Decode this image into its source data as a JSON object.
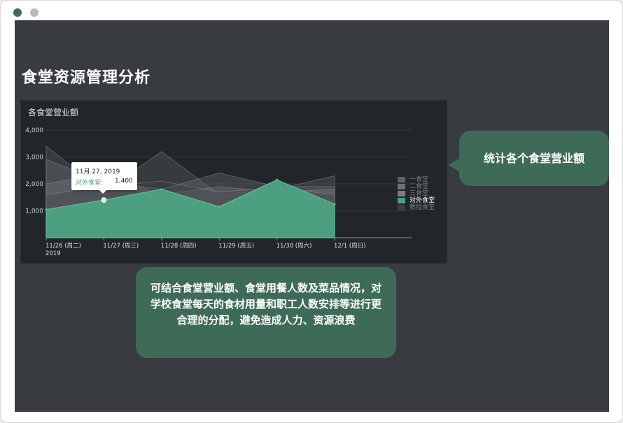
{
  "window": {
    "controls": [
      "close",
      "minimize"
    ]
  },
  "page": {
    "title": "食堂资源管理分析"
  },
  "chart_data": {
    "type": "area",
    "title": "各食堂营业额",
    "categories": [
      "11/26 (周二)",
      "11/27 (周三)",
      "11/28 (周四)",
      "11/29 (周五)",
      "11/30 (周六)",
      "12/1 (周日)"
    ],
    "x_sublabel": "2019",
    "ylim": [
      0,
      4000
    ],
    "yticks": [
      "1,000",
      "2,000",
      "3,000",
      "4,000"
    ],
    "grid": true,
    "legend_position": "right",
    "series": [
      {
        "name": "一食堂",
        "values": [
          3400,
          1700,
          3200,
          1600,
          1800,
          2300
        ],
        "color": "#5f6368"
      },
      {
        "name": "二食堂",
        "values": [
          2900,
          2100,
          1800,
          2400,
          1900,
          1900
        ],
        "color": "#6d7175"
      },
      {
        "name": "三食堂",
        "values": [
          2000,
          2400,
          1600,
          1900,
          1700,
          1800
        ],
        "color": "#7b7f83"
      },
      {
        "name": "对外食堂",
        "values": [
          1050,
          1400,
          1800,
          1150,
          2150,
          1250
        ],
        "color": "#4ca382"
      },
      {
        "name": "教授食堂",
        "values": [
          1600,
          1900,
          2100,
          1700,
          1850,
          1600
        ],
        "color": "#3b3f43"
      }
    ],
    "legend": [
      "一食堂",
      "二食堂",
      "三食堂",
      "对外食堂",
      "教授食堂"
    ],
    "highlighted_series": "对外食堂"
  },
  "tooltip": {
    "date": "11月 27, 2019",
    "series": "对外食堂:",
    "value": "1,400"
  },
  "callouts": {
    "right": "统计各个食堂营业额",
    "bottom": "可结合食堂营业额、食堂用餐人数及菜品情况，对学校食堂每天的食材用量和职工人数安排等进行更合理的分配，避免造成人力、资源浪费"
  }
}
